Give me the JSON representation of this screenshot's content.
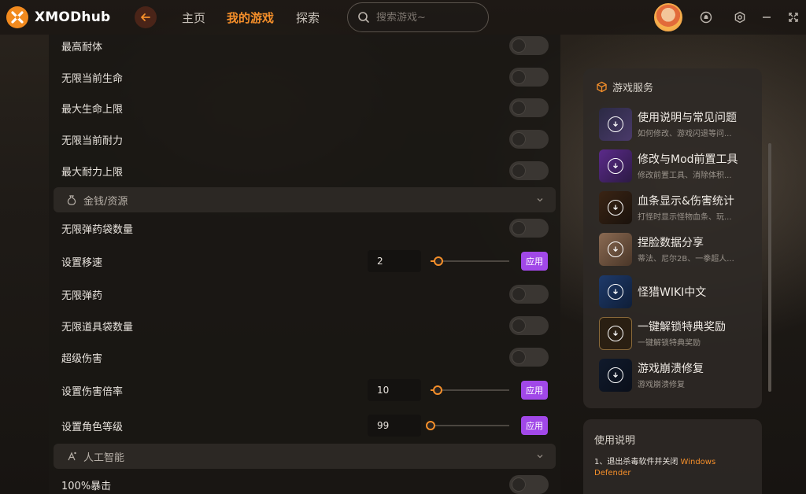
{
  "app": {
    "name": "XMODhub"
  },
  "nav": {
    "items": [
      {
        "label": "主页",
        "active": false
      },
      {
        "label": "我的游戏",
        "active": true
      },
      {
        "label": "探索",
        "active": false
      }
    ]
  },
  "search": {
    "placeholder": "搜索游戏~"
  },
  "colors": {
    "accent": "#f58f2a",
    "apply": "#a148e8"
  },
  "left": {
    "rows": [
      {
        "type": "toggle",
        "label": "最高耐体"
      },
      {
        "type": "toggle",
        "label": "无限当前生命"
      },
      {
        "type": "toggle",
        "label": "最大生命上限"
      },
      {
        "type": "toggle",
        "label": "无限当前耐力"
      },
      {
        "type": "toggle",
        "label": "最大耐力上限"
      },
      {
        "type": "section",
        "label": "金钱/资源"
      },
      {
        "type": "toggle",
        "label": "无限弹药袋数量"
      },
      {
        "type": "slider",
        "label": "设置移速",
        "value": "2",
        "apply": "应用"
      },
      {
        "type": "toggle",
        "label": "无限弹药"
      },
      {
        "type": "toggle",
        "label": "无限道具袋数量"
      },
      {
        "type": "toggle",
        "label": "超级伤害"
      },
      {
        "type": "slider",
        "label": "设置伤害倍率",
        "value": "10",
        "apply": "应用"
      },
      {
        "type": "slider",
        "label": "设置角色等级",
        "value": "99",
        "apply": "应用"
      },
      {
        "type": "section",
        "label": "人工智能"
      },
      {
        "type": "toggle",
        "label": "100%暴击"
      }
    ]
  },
  "services": {
    "title": "游戏服务",
    "items": [
      {
        "name": "使用说明与常见问题",
        "desc": "如何修改、游戏闪退等问...",
        "icon": "download-icon"
      },
      {
        "name": "修改与Mod前置工具",
        "desc": "修改前置工具、消除体积...",
        "icon": "download-icon"
      },
      {
        "name": "血条显示&伤害统计",
        "desc": "打怪时显示怪物血条、玩...",
        "icon": "download-icon"
      },
      {
        "name": "捏脸数据分享",
        "desc": "蒂法、尼尔2B、一拳超人...",
        "icon": "download-icon"
      },
      {
        "name": "怪猎WIKI中文",
        "desc": "",
        "icon": "download-icon"
      },
      {
        "name": "一键解锁特典奖励",
        "desc": "一键解锁特典奖励",
        "icon": "download-icon"
      },
      {
        "name": "游戏崩溃修复",
        "desc": "游戏崩溃修复",
        "icon": "download-icon"
      }
    ]
  },
  "usage": {
    "title": "使用说明",
    "line_prefix": "1、退出杀毒软件并关闭 ",
    "line_highlight": "Windows Defender"
  }
}
